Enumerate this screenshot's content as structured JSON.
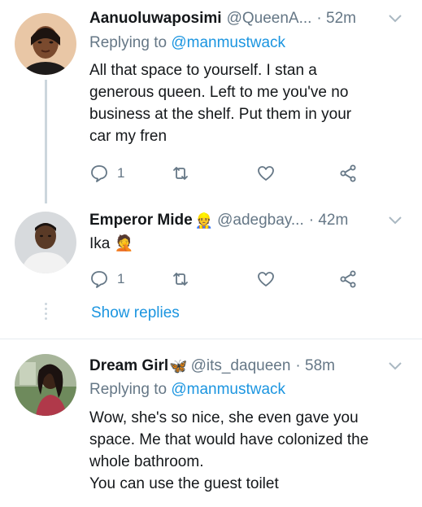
{
  "tweets": [
    {
      "name": "Aanuoluwaposimi",
      "name_emoji": "",
      "handle": "@QueenA...",
      "time": "· 52m",
      "replying_prefix": "Replying to",
      "replying_to": "@manmustwack",
      "text_lines": [
        "All that space to yourself. I stan a",
        "generous queen. Left to me you've no",
        "business at the shelf. Put them in your",
        "car my fren"
      ],
      "reply_count": "1",
      "avatar_icon": "avatar-woman-icon"
    },
    {
      "name": "Emperor Mide",
      "name_emoji": "👷",
      "handle": "@adegbay...",
      "time": "· 42m",
      "text": "Ika",
      "text_emoji": "🤦",
      "reply_count": "1",
      "avatar_icon": "avatar-man-icon"
    },
    {
      "name": "Dream Girl",
      "name_emoji": "🦋",
      "handle": "@its_daqueen",
      "time": "· 58m",
      "replying_prefix": "Replying to",
      "replying_to": "@manmustwack",
      "text_lines": [
        "Wow, she's so nice, she even gave you",
        "space. Me that would have colonized the",
        "whole bathroom.",
        "You can use the guest toilet"
      ],
      "avatar_icon": "avatar-illustration-icon"
    }
  ],
  "thread": {
    "show_replies_label": "Show replies"
  },
  "colors": {
    "link": "#1b95e0",
    "secondary": "#657786",
    "divider": "#e6ecf0",
    "icon": "#657786"
  }
}
